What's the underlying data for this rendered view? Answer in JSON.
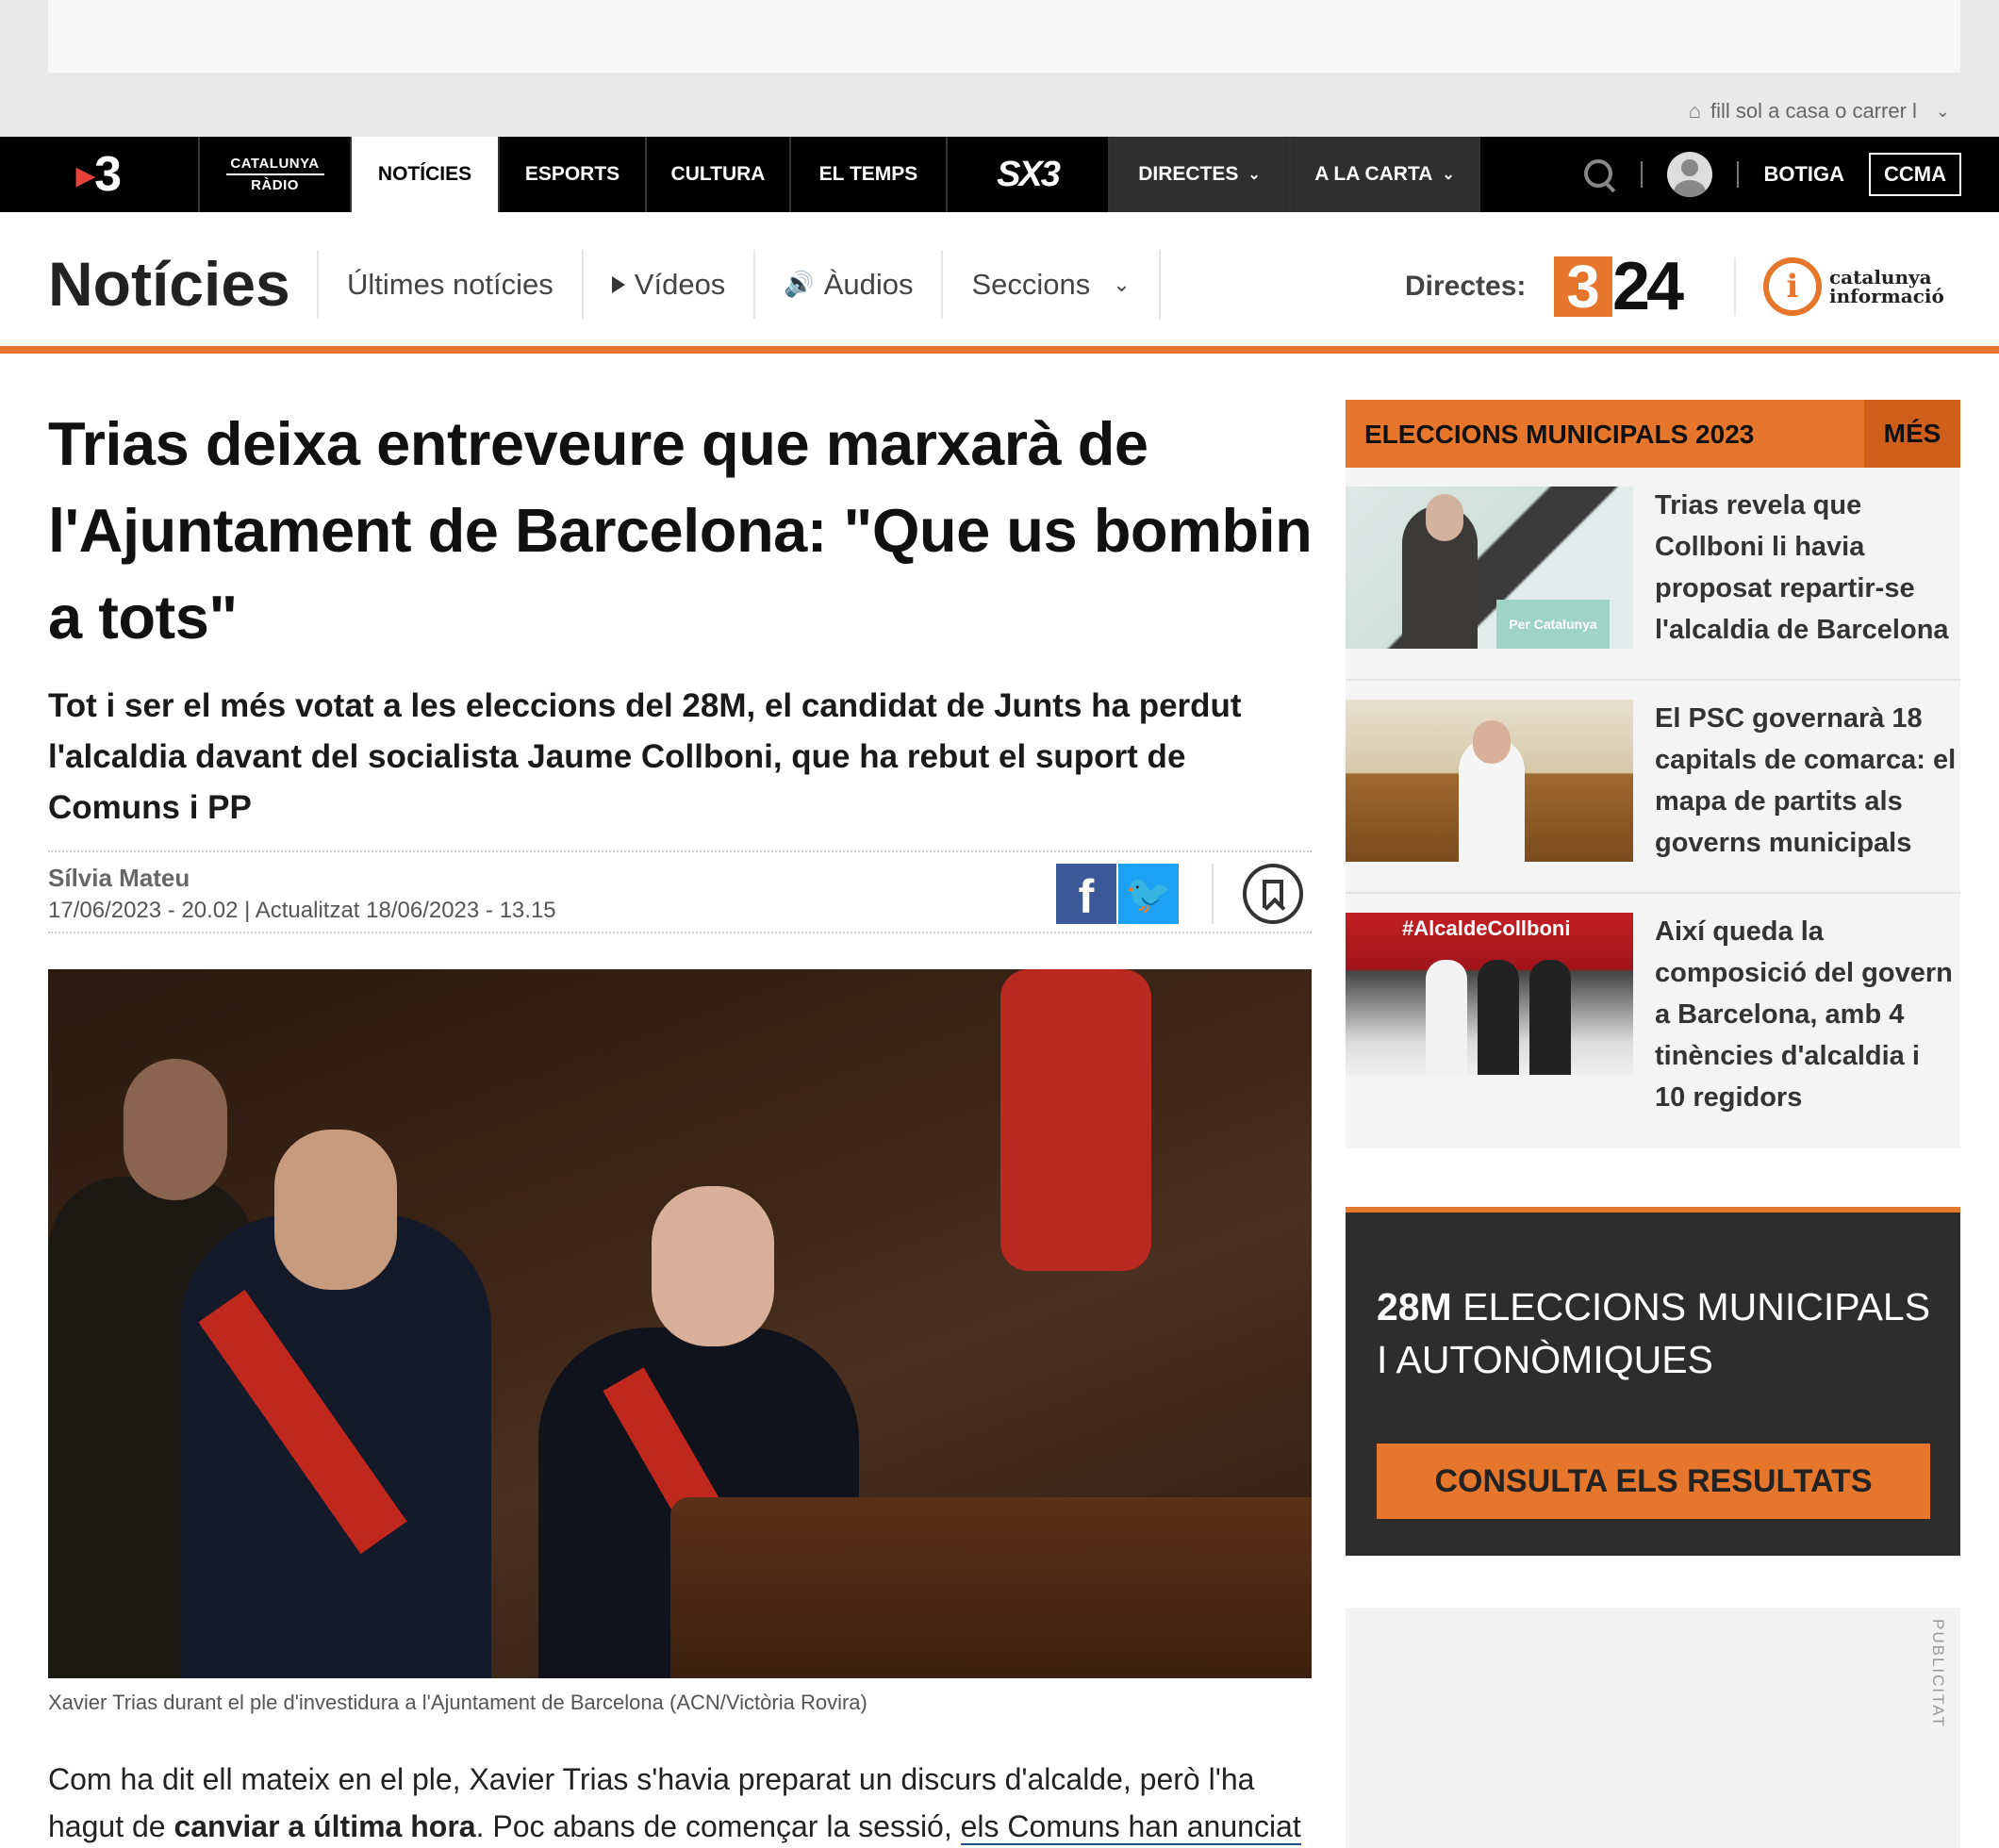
{
  "ad_tag": {
    "label": "fill sol a casa o carrer l"
  },
  "topnav": {
    "radio": [
      "CATALUNYA",
      "RÀDIO"
    ],
    "items": [
      "NOTÍCIES",
      "ESPORTS",
      "CULTURA",
      "EL TEMPS"
    ],
    "sx3": "SX3",
    "directes": "DIRECTES",
    "alacarta": "A LA CARTA",
    "botiga": "BOTIGA",
    "ccma": "CCMA"
  },
  "section": {
    "title": "Notícies",
    "menu": [
      "Últimes notícies",
      "Vídeos",
      "Àudios",
      "Seccions"
    ],
    "directes": "Directes:",
    "channel_324": [
      "3",
      "24"
    ],
    "ci": [
      "catalunya",
      "informació"
    ]
  },
  "article": {
    "headline": "Trias deixa entreveure que marxarà de l'Ajuntament de Barcelona: \"Que us bombin a tots\"",
    "subhead": "Tot i ser el més votat a les eleccions del 28M, el candidat de Junts ha perdut l'alcaldia davant del socialista Jaume Collboni, que ha rebut el suport de Comuns i PP",
    "author": "Sílvia Mateu",
    "dates": "17/06/2023 - 20.02 | Actualitzat 18/06/2023 - 13.15",
    "caption": "Xavier Trias durant el ple d'investidura a l'Ajuntament de Barcelona (ACN/Victòria Rovira)",
    "body": {
      "p1": "Com ha dit ell mateix en el ple, Xavier Trias s'havia preparat un discurs d'alcalde, però l'ha",
      "p2a": "hagut de ",
      "p2b": "canviar a última hora",
      "p2c": ". Poc abans de començar la sessió, ",
      "p2d": "els Comuns han anunciat"
    }
  },
  "sidebar": {
    "header": "ELECCIONS MUNICIPALS 2023",
    "more": "MÉS",
    "items": [
      {
        "title": "Trias revela que Collboni li havia proposat repartir-se l'alcaldia de Barcelona",
        "podium": "Per Catalunya"
      },
      {
        "title": "El PSC governarà 18 capitals de comarca: el mapa de partits als governs municipals"
      },
      {
        "title": "Així queda la composició del govern a Barcelona, amb 4 tinències d'alcaldia i 10 regidors",
        "banner": "#AlcaldeCollboni"
      }
    ],
    "results": {
      "title_bold": "28M",
      "title_rest": " ELECCIONS MUNICIPALS I AUTONÒMIQUES",
      "button": "CONSULTA ELS RESULTATS"
    },
    "ad_label": "PUBLICITAT"
  }
}
